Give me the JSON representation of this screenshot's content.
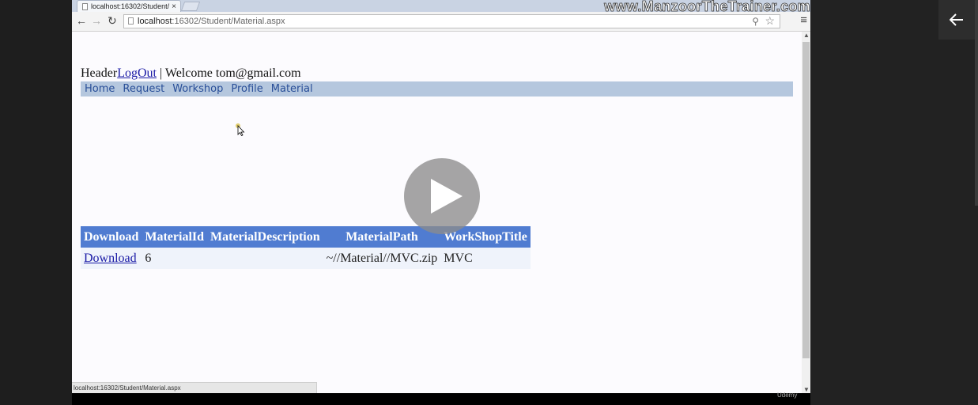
{
  "browser": {
    "tab_title": "localhost:16302/Student/",
    "tab_close": "×",
    "url_host": "localhost",
    "url_path": ":16302/Student/Material.aspx",
    "status_url": "localhost:16302/Student/Material.aspx"
  },
  "watermark": "www.ManzoorTheTrainer.com",
  "page": {
    "header_text": "Header",
    "logout_link": "LogOut",
    "welcome_text": " | Welcome tom@gmail.com",
    "menu": [
      "Home",
      "Request",
      "Workshop",
      "Profile",
      "Material"
    ]
  },
  "grid": {
    "columns": [
      "Download",
      "MaterialId",
      "MaterialDescription",
      "MaterialPath",
      "WorkShopTitle"
    ],
    "rows": [
      {
        "download": "Download",
        "material_id": "6",
        "material_description": "",
        "material_path": "~//Material//MVC.zip",
        "workshop_title": "MVC"
      }
    ]
  },
  "player": {
    "udemy_label": "Udemy"
  },
  "colors": {
    "grid_header_bg": "#507cd1",
    "grid_row_bg": "#eff3fb",
    "menu_bg": "#b5c7de",
    "menu_text": "#284e98",
    "link": "#1a1aa6"
  },
  "icons": [
    "back-arrow-icon",
    "forward-arrow-icon",
    "reload-icon",
    "page-icon",
    "zoom-icon",
    "star-icon",
    "menu-icon",
    "play-icon",
    "cursor-icon"
  ]
}
